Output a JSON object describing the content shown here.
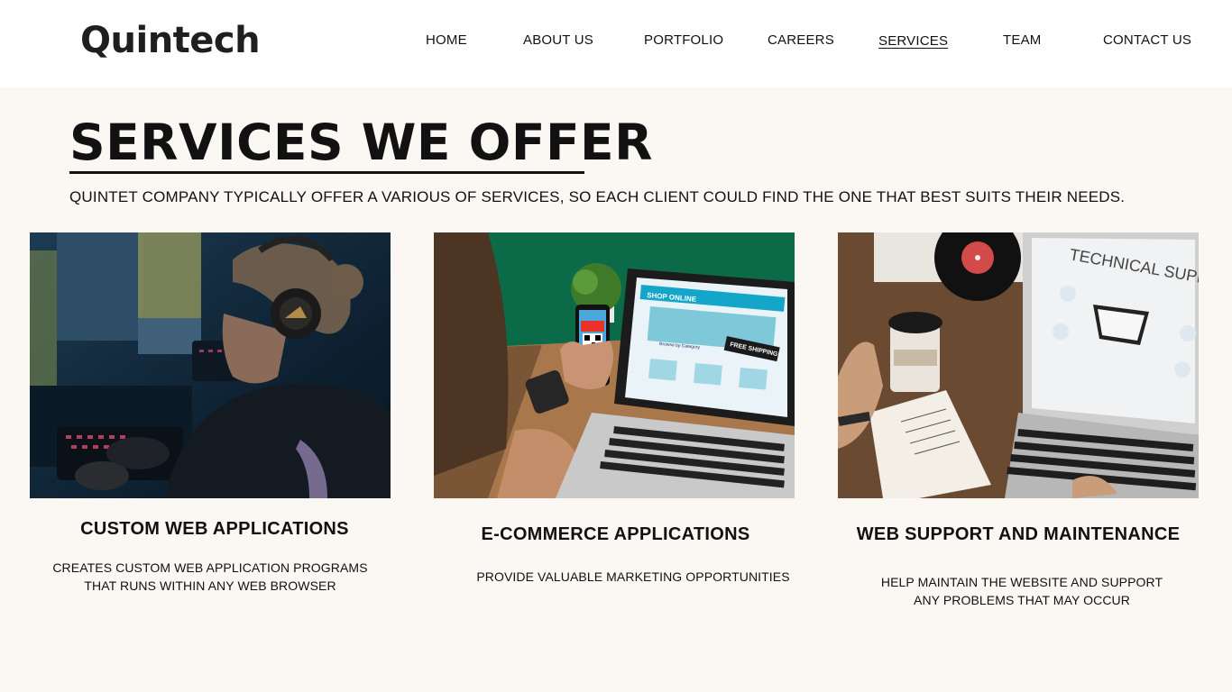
{
  "header": {
    "logo": "Quintech",
    "nav": [
      {
        "label": "HOME",
        "active": false
      },
      {
        "label": "ABOUT US",
        "active": false
      },
      {
        "label": "PORTFOLIO",
        "active": false
      },
      {
        "label": "CAREERS",
        "active": false
      },
      {
        "label": "SERVICES",
        "active": true
      },
      {
        "label": "TEAM",
        "active": false
      },
      {
        "label": "CONTACT US",
        "active": false
      }
    ]
  },
  "main": {
    "title": "SERVICES WE OFFER",
    "subtitle": "QUINTET COMPANY TYPICALLY OFFER A VARIOUS OF SERVICES, SO EACH CLIENT COULD FIND THE ONE THAT BEST SUITS THEIR NEEDS.",
    "services": [
      {
        "title": "CUSTOM WEB APPLICATIONS",
        "desc_line1": "CREATES CUSTOM WEB APPLICATION PROGRAMS",
        "desc_line2": "THAT RUNS WITHIN ANY WEB BROWSER",
        "image_subject": "developer wearing headphones at computer"
      },
      {
        "title": "E-COMMERCE APPLICATIONS",
        "desc_line1": "PROVIDE VALUABLE MARKETING OPPORTUNITIES",
        "desc_line2": "",
        "image_subject": "phone with QR code and laptop showing online shop",
        "image_text": {
          "shop": "SHOP ONLINE",
          "shipping": "FREE SHIPPING!",
          "browse": "Browse by Category"
        }
      },
      {
        "title": "WEB SUPPORT AND MAINTENANCE",
        "desc_line1": "HELP MAINTAIN THE WEBSITE AND SUPPORT",
        "desc_line2": "ANY PROBLEMS THAT MAY OCCUR",
        "image_subject": "laptop showing technical support screen",
        "image_text": {
          "screen": "TECHNICAL SUPPORT"
        }
      }
    ]
  },
  "colors": {
    "page_bg": "#fbf8f3",
    "header_bg": "#ffffff",
    "text": "#111111"
  }
}
